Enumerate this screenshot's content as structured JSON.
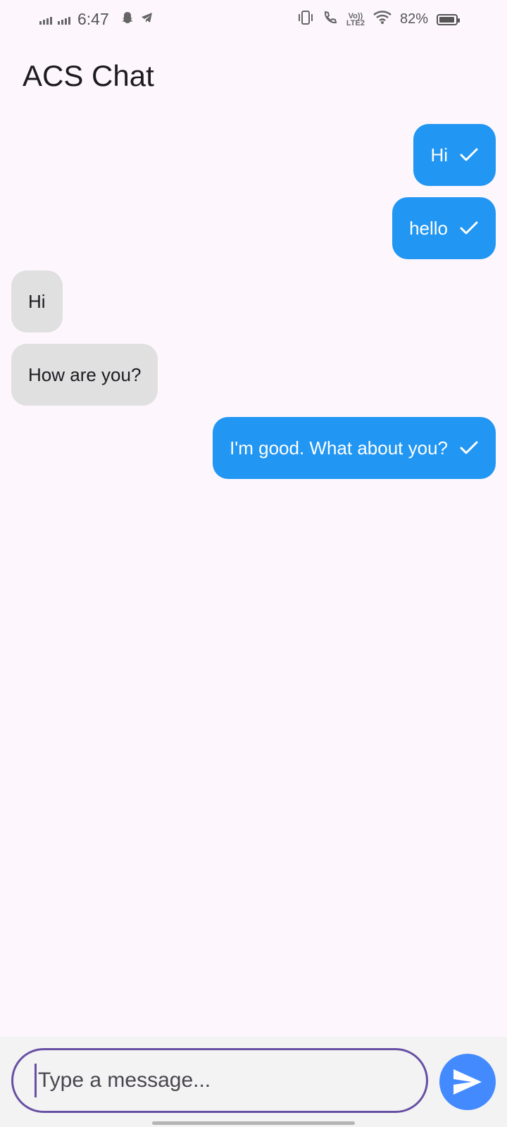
{
  "status_bar": {
    "time": "6:47",
    "battery_percent": "82%",
    "battery_level": 0.82,
    "icons": [
      "signal-icon",
      "signal-icon",
      "snapchat-icon",
      "telegram-icon",
      "vibrate-icon",
      "wifi-calling-icon",
      "volte-icon",
      "wifi-icon",
      "battery-icon"
    ]
  },
  "header": {
    "title": "ACS Chat"
  },
  "messages": [
    {
      "text": "Hi",
      "direction": "sent",
      "status_icon": "check-icon"
    },
    {
      "text": "hello",
      "direction": "sent",
      "status_icon": "check-icon"
    },
    {
      "text": "Hi",
      "direction": "received"
    },
    {
      "text": "How are you?",
      "direction": "received"
    },
    {
      "text": "I'm good. What about you?",
      "direction": "sent",
      "status_icon": "check-icon"
    }
  ],
  "composer": {
    "placeholder": "Type a message...",
    "value": "",
    "send_icon": "send-icon"
  },
  "colors": {
    "background": "#fdf7fd",
    "sent_bubble": "#2196f3",
    "received_bubble": "#e0e0e0",
    "input_border": "#6750a4",
    "send_button": "#448aff"
  }
}
